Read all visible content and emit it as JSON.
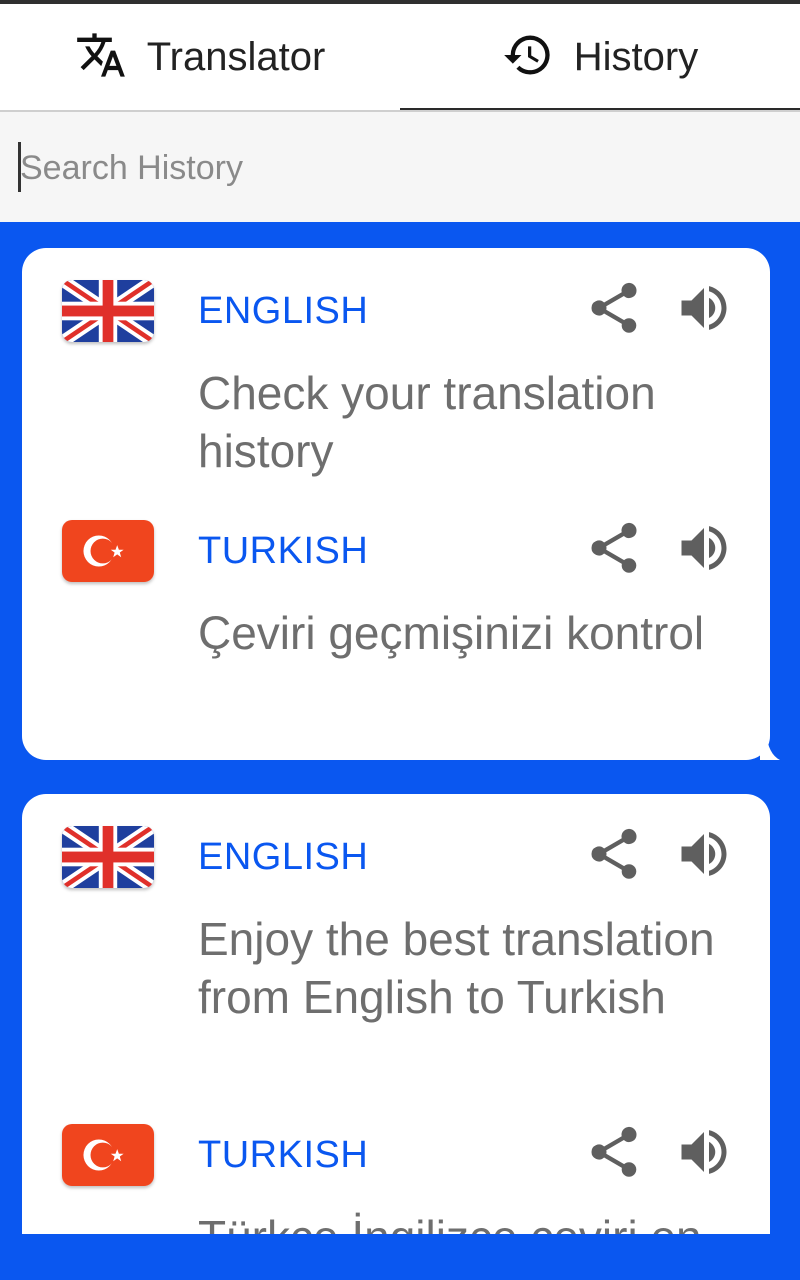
{
  "tabs": [
    {
      "label": "Translator",
      "icon": "translate-icon",
      "selected": false
    },
    {
      "label": "History",
      "icon": "history-icon",
      "selected": true
    }
  ],
  "search": {
    "placeholder": "Search History",
    "value": ""
  },
  "colors": {
    "accent": "#0a57f0",
    "text_gray": "#6e6e6e",
    "lang_blue": "#0a57f0"
  },
  "history": [
    {
      "source": {
        "language": "ENGLISH",
        "flag": "uk-flag-icon",
        "text": "Check your translation history"
      },
      "target": {
        "language": "TURKISH",
        "flag": "turkey-flag-icon",
        "text": "Çeviri geçmişinizi kontrol"
      }
    },
    {
      "source": {
        "language": "ENGLISH",
        "flag": "uk-flag-icon",
        "text": "Enjoy the best translation from  English to Turkish"
      },
      "target": {
        "language": "TURKISH",
        "flag": "turkey-flag-icon",
        "text": "Türkçe İngilizce çeviri en"
      }
    }
  ]
}
